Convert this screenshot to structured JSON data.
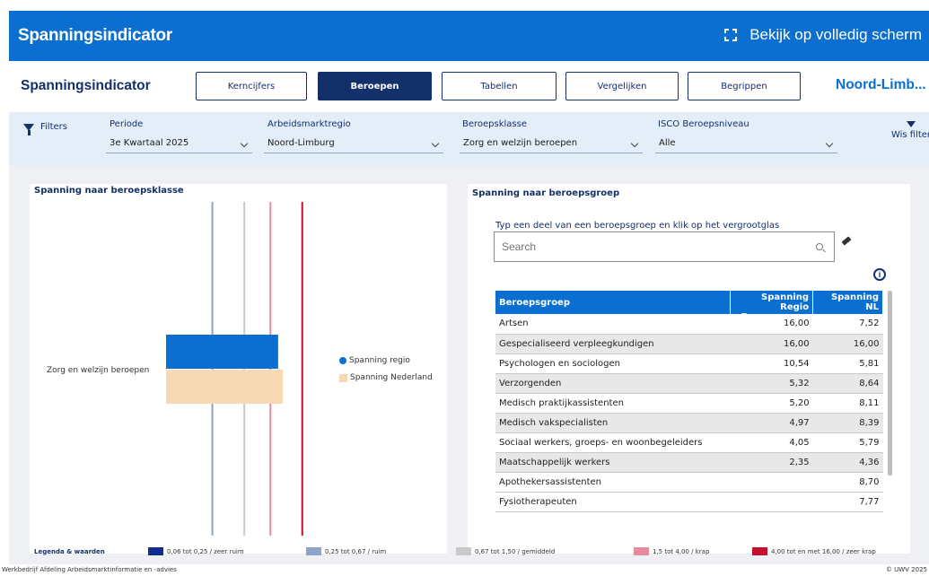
{
  "topbar": {
    "title": "Spanningsindicator",
    "fullscreen_label": "Bekijk op volledig scherm"
  },
  "nav": {
    "title": "Spanningsindicator",
    "tabs": [
      "Kerncijfers",
      "Beroepen",
      "Tabellen",
      "Vergelijken",
      "Begrippen"
    ],
    "active_tab": "Beroepen",
    "region": "Noord-Limb..."
  },
  "filters": {
    "label": "Filters",
    "periode": {
      "label": "Periode",
      "value": "3e Kwartaal 2025"
    },
    "regio": {
      "label": "Arbeidsmarktregio",
      "value": "Noord-Limburg"
    },
    "beroepsklasse": {
      "label": "Beroepsklasse",
      "value": "Zorg en welzijn beroepen"
    },
    "isco": {
      "label": "ISCO Beroepsniveau",
      "value": "Alle"
    },
    "clear_label": "Wis filter"
  },
  "left_card": {
    "title": "Spanning naar beroepsklasse",
    "category": "Zorg en welzijn beroepen",
    "legend": {
      "regio": "Spanning regio",
      "nederland": "Spanning Nederland"
    }
  },
  "chart_data": {
    "type": "bar",
    "orientation": "horizontal",
    "categories": [
      "Zorg en welzijn beroepen"
    ],
    "series": [
      {
        "name": "Spanning regio",
        "values": [
          1.9
        ],
        "color": "#0a6fd1"
      },
      {
        "name": "Spanning Nederland",
        "values": [
          2.2
        ],
        "color": "#f8d9b6"
      }
    ],
    "reference_lines": [
      {
        "value": 0.25,
        "color": "#8ea3c9"
      },
      {
        "value": 0.67,
        "color": "#c9c9c9"
      },
      {
        "value": 1.5,
        "color": "#e88a9c"
      },
      {
        "value": 4.0,
        "color": "#c4102e"
      }
    ]
  },
  "right_card": {
    "title": "Spanning naar beroepsgroep",
    "search_hint": "Typ een deel van een beroepsgroep en klik op het vergrootglas",
    "search_placeholder": "Search",
    "info_glyph": "i",
    "columns": [
      "Beroepsgroep",
      "Spanning Regio",
      "Spanning NL"
    ],
    "rows": [
      {
        "name": "Artsen",
        "regio": "16,00",
        "nl": "7,52"
      },
      {
        "name": "Gespecialiseerd verpleegkundigen",
        "regio": "16,00",
        "nl": "16,00"
      },
      {
        "name": "Psychologen en sociologen",
        "regio": "10,54",
        "nl": "5,81"
      },
      {
        "name": "Verzorgenden",
        "regio": "5,32",
        "nl": "8,64"
      },
      {
        "name": "Medisch praktijkassistenten",
        "regio": "5,20",
        "nl": "8,11"
      },
      {
        "name": "Medisch vakspecialisten",
        "regio": "4,97",
        "nl": "8,39"
      },
      {
        "name": "Sociaal werkers, groeps- en woonbegeleiders",
        "regio": "4,05",
        "nl": "5,79"
      },
      {
        "name": "Maatschappelijk werkers",
        "regio": "2,35",
        "nl": "4,36"
      },
      {
        "name": "Apothekersassistenten",
        "regio": "",
        "nl": "8,70"
      },
      {
        "name": "Fysiotherapeuten",
        "regio": "",
        "nl": "7,77"
      }
    ]
  },
  "legend_bar": {
    "title": "Legenda & waarden",
    "items": [
      {
        "label": "0,06 tot 0,25 / zeer ruim",
        "color": "#0f2d8a"
      },
      {
        "label": "0,25 tot 0,67 / ruim",
        "color": "#8ea3c9"
      },
      {
        "label": "0,67 tot 1,50 / gemiddeld",
        "color": "#c9c9c9"
      },
      {
        "label": "1,5 tot 4,00 / krap",
        "color": "#e88a9c"
      },
      {
        "label": "4,00 tot en met 16,00 / zeer krap",
        "color": "#c4102e"
      }
    ]
  },
  "footer": {
    "left": "Werkbedrijf Afdeling Arbeidsmarktinformatie en -advies",
    "right": "© UWV 2025"
  }
}
